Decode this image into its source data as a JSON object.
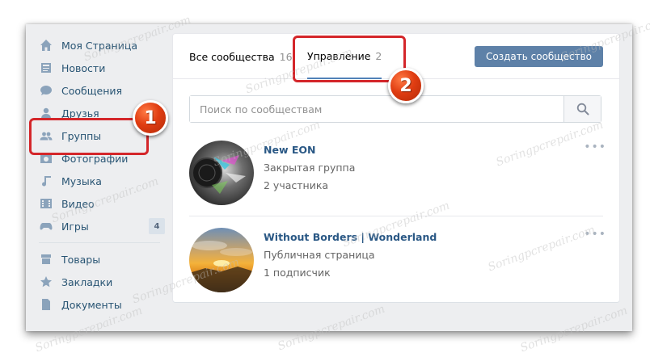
{
  "sidebar": {
    "items": [
      {
        "label": "Моя Страница",
        "icon": "home-icon"
      },
      {
        "label": "Новости",
        "icon": "news-icon"
      },
      {
        "label": "Сообщения",
        "icon": "message-icon"
      },
      {
        "label": "Друзья",
        "icon": "user-icon"
      },
      {
        "label": "Группы",
        "icon": "groups-icon"
      },
      {
        "label": "Фотографии",
        "icon": "camera-icon"
      },
      {
        "label": "Музыка",
        "icon": "music-icon"
      },
      {
        "label": "Видео",
        "icon": "video-icon"
      },
      {
        "label": "Игры",
        "icon": "gamepad-icon",
        "badge": "4"
      },
      {
        "label": "Товары",
        "icon": "shop-icon"
      },
      {
        "label": "Закладки",
        "icon": "star-icon"
      },
      {
        "label": "Документы",
        "icon": "document-icon"
      }
    ]
  },
  "tabs": [
    {
      "label": "Все сообщества",
      "count": "16"
    },
    {
      "label": "Управление",
      "count": "2"
    }
  ],
  "create_button": "Создать сообщество",
  "search": {
    "placeholder": "Поиск по сообществам"
  },
  "groups": [
    {
      "name": "New EON",
      "type": "Закрытая группа",
      "members": "2 участника",
      "more": "•••"
    },
    {
      "name": "Without Borders | Wonderland",
      "type": "Публичная страница",
      "members": "1 подписчик",
      "more": "•••"
    }
  ],
  "callouts": {
    "one": "1",
    "two": "2"
  },
  "watermark": "Soringpcrepair.com",
  "colors": {
    "accent": "#5181b8",
    "button": "#5e81a8",
    "link": "#2a5885",
    "highlight": "#d4262a",
    "callout": "#e03d12"
  }
}
